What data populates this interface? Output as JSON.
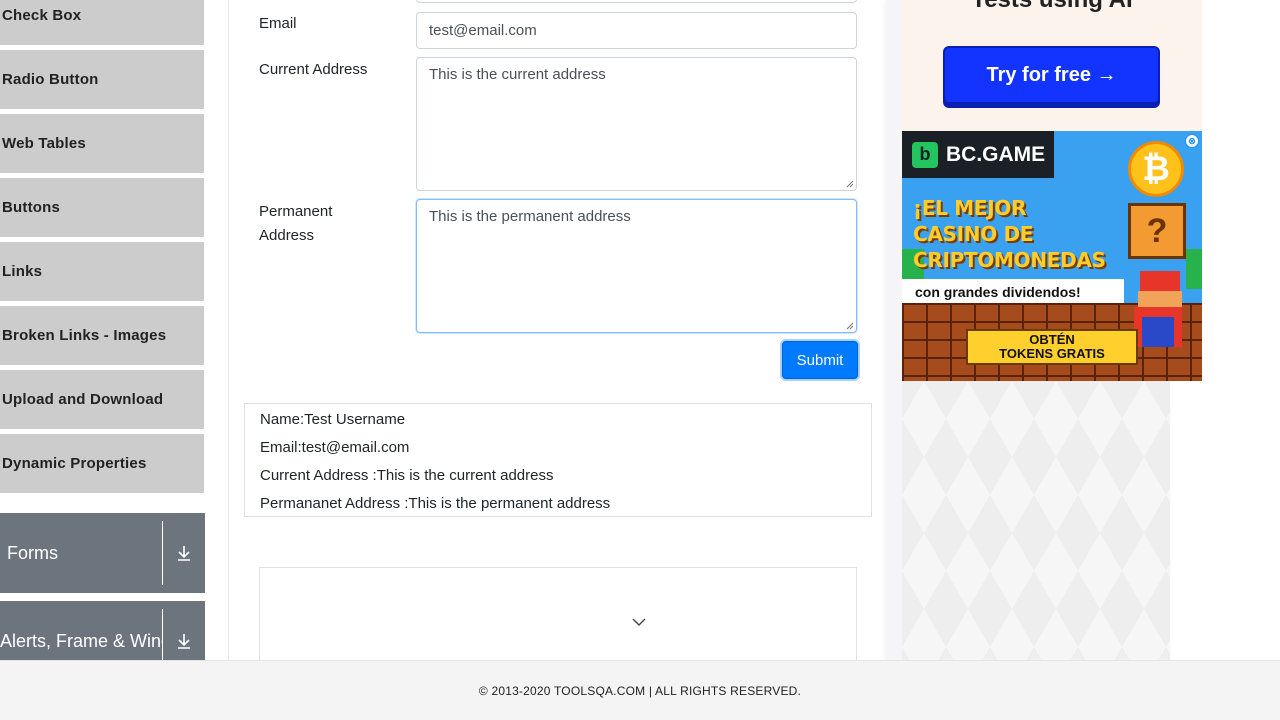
{
  "sidebar": {
    "items": [
      {
        "label": "Check Box"
      },
      {
        "label": "Radio Button"
      },
      {
        "label": "Web Tables"
      },
      {
        "label": "Buttons"
      },
      {
        "label": "Links"
      },
      {
        "label": "Broken Links - Images"
      },
      {
        "label": "Upload and Download"
      },
      {
        "label": "Dynamic Properties"
      }
    ],
    "groups": [
      {
        "label": "Forms",
        "icon": "download-arrow-icon"
      },
      {
        "label": "Alerts, Frame & Windows",
        "icon": "download-arrow-icon"
      }
    ]
  },
  "form": {
    "email_label": "Email",
    "email_value": "test@email.com",
    "current_address_label": "Current Address",
    "current_address_value": "This is the current address",
    "permanent_address_label_line1": "Permanent",
    "permanent_address_label_line2": "Address",
    "permanent_address_value": "This is the permanent address",
    "submit_label": "Submit"
  },
  "output": {
    "name": "Name:Test Username",
    "email": "Email:test@email.com",
    "current_address": "Current Address :This is the current address",
    "permanent_address": "Permananet Address :This is the permanent address"
  },
  "ads": {
    "top_tagline": "Tests using AI",
    "try_button": "Try for free →",
    "bc_brand": "BC.GAME",
    "bc_headline_1": "¡EL MEJOR",
    "bc_headline_2": "CASINO DE",
    "bc_headline_3": "CRIPTOMONEDAS",
    "bc_sub": "con grandes dividendos!",
    "bc_cta_1": "OBTÉN",
    "bc_cta_2": "TOKENS GRATIS",
    "ad_badge": "⊗"
  },
  "footer": {
    "text": "© 2013-2020 TOOLSQA.COM | ALL RIGHTS RESERVED."
  },
  "colors": {
    "primary": "#007bff",
    "sidebar_item": "#cccccc",
    "group_header": "#6c757d"
  }
}
